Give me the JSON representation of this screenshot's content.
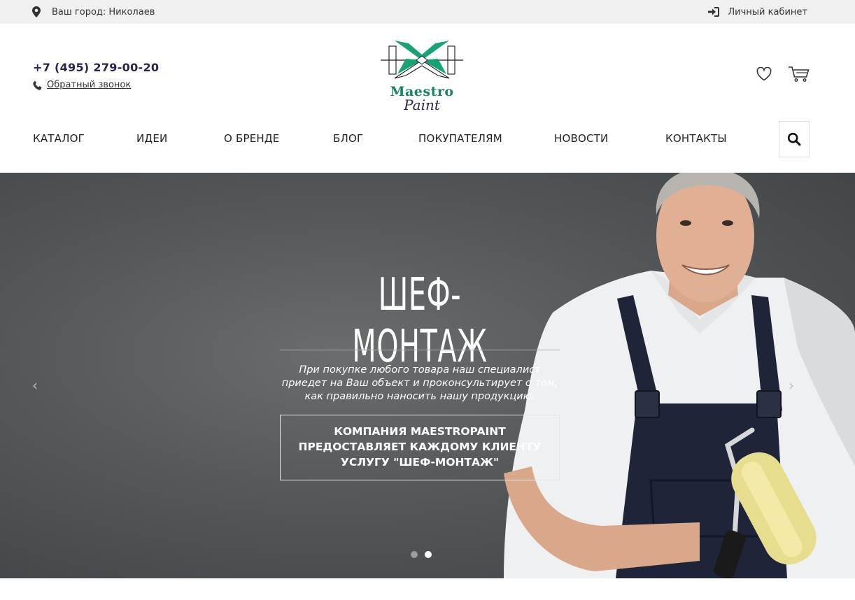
{
  "topbar": {
    "city_label": "Ваш город: Николаев",
    "cabinet_label": "Личный кабинет"
  },
  "header": {
    "phone": "+7 (495) 279-00-20",
    "callback_label": "Обратный звонок",
    "logo": {
      "line1": "Maestro",
      "line2": "Paint"
    }
  },
  "nav": {
    "items": [
      "КАТАЛОГ",
      "ИДЕИ",
      "О БРЕНДЕ",
      "БЛОГ",
      "ПОКУПАТЕЛЯМ",
      "НОВОСТИ",
      "КОНТАКТЫ"
    ]
  },
  "hero": {
    "title": "ШЕФ-МОНТАЖ",
    "text": "При покупке любого товара наш специалист приедет на Ваш объект и проконсультирует о том, как правильно наносить нашу продукцию.",
    "button_label": "КОМПАНИЯ MAESTROPAINT ПРЕДОСТАВЛЯЕТ КАЖДОМУ КЛИЕНТУ УСЛУГУ \"ШЕФ-МОНТАЖ\"",
    "prev_arrow": "‹",
    "next_arrow": "›",
    "slides_total": 2,
    "active_slide": 2
  },
  "colors": {
    "brand_green": "#16855f",
    "brand_navy": "#2a2350",
    "topbar_bg": "#f0f0f0"
  },
  "icons": [
    "location-pin-icon",
    "login-icon",
    "phone-icon",
    "heart-icon",
    "cart-icon",
    "search-icon"
  ]
}
